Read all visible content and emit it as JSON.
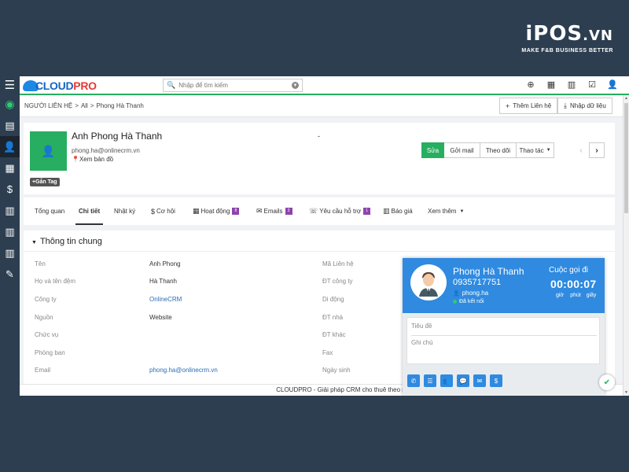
{
  "brand": {
    "logo_main": "iPOS",
    "logo_suffix": ".VN",
    "tagline": "MAKE F&B BUSINESS BETTER"
  },
  "topbar": {
    "logo_part1": "CLOUD",
    "logo_part2": "PRO",
    "search_placeholder": "Nhập để tìm kiếm",
    "icons": [
      "plus-circle-icon",
      "calendar-icon",
      "bar-chart-icon",
      "check-square-icon",
      "user-icon"
    ]
  },
  "sidebar": {
    "icons": [
      "menu-icon",
      "dashboard-icon",
      "contacts-card-icon",
      "person-icon",
      "building-icon",
      "money-bag-icon",
      "document-icon",
      "document-icon",
      "document-icon",
      "edit-icon"
    ]
  },
  "breadcrumb": {
    "module": "NGƯỜI LIÊN HỆ",
    "sep": ">",
    "filter": "All",
    "record": "Phong Hà Thanh"
  },
  "header_buttons": {
    "add": "Thêm Liên hệ",
    "import": "Nhập dữ liệu"
  },
  "profile": {
    "name": "Anh Phong Hà Thanh",
    "email": "phong.ha@onlinecrm.vn",
    "map": "Xem bản đồ",
    "dash": "-",
    "tag": "Gắn Tag"
  },
  "actions": {
    "edit": "Sửa",
    "send_mail": "Gởi mail",
    "follow": "Theo dõi",
    "more": "Thao tác"
  },
  "tabs": [
    {
      "label": "Tổng quan"
    },
    {
      "label": "Chi tiết"
    },
    {
      "label": "Nhật ký"
    },
    {
      "label": "Cơ hội"
    },
    {
      "label": "Hoạt động",
      "badge": "8"
    },
    {
      "label": "Emails",
      "badge": "3"
    },
    {
      "label": "Yêu cầu hỗ trợ",
      "badge": "1"
    },
    {
      "label": "Báo giá"
    },
    {
      "label": "Xem thêm"
    }
  ],
  "section_title": "Thông tin chung",
  "fields_left": [
    {
      "label": "Tên",
      "value": "Anh Phong"
    },
    {
      "label": "Họ và tên đệm",
      "value": "Hà Thanh"
    },
    {
      "label": "Công ty",
      "value": "OnlineCRM"
    },
    {
      "label": "Nguồn",
      "value": "Website"
    },
    {
      "label": "Chức vụ",
      "value": ""
    },
    {
      "label": "Phòng ban",
      "value": ""
    },
    {
      "label": "Email",
      "value": "phong.ha@onlinecrm.vn"
    }
  ],
  "fields_right": [
    {
      "label": "Mã Liên hệ"
    },
    {
      "label": "ĐT công ty"
    },
    {
      "label": "Di động"
    },
    {
      "label": "ĐT nhà"
    },
    {
      "label": "ĐT khác"
    },
    {
      "label": "Fax"
    },
    {
      "label": "Ngày sinh"
    }
  ],
  "footer": "CLOUDPRO - Giải pháp CRM cho thuê theo ngành,",
  "call_popup": {
    "name": "Phong Hà Thanh",
    "phone": "0935717751",
    "user": "phong.ha",
    "status": "Đã kết nối",
    "title": "Cuộc gọi đi",
    "timer": "00:00:07",
    "unit_h": "giờ",
    "unit_m": "phút",
    "unit_s": "giây",
    "subject_placeholder": "Tiêu đề",
    "notes_placeholder": "Ghi chú"
  }
}
